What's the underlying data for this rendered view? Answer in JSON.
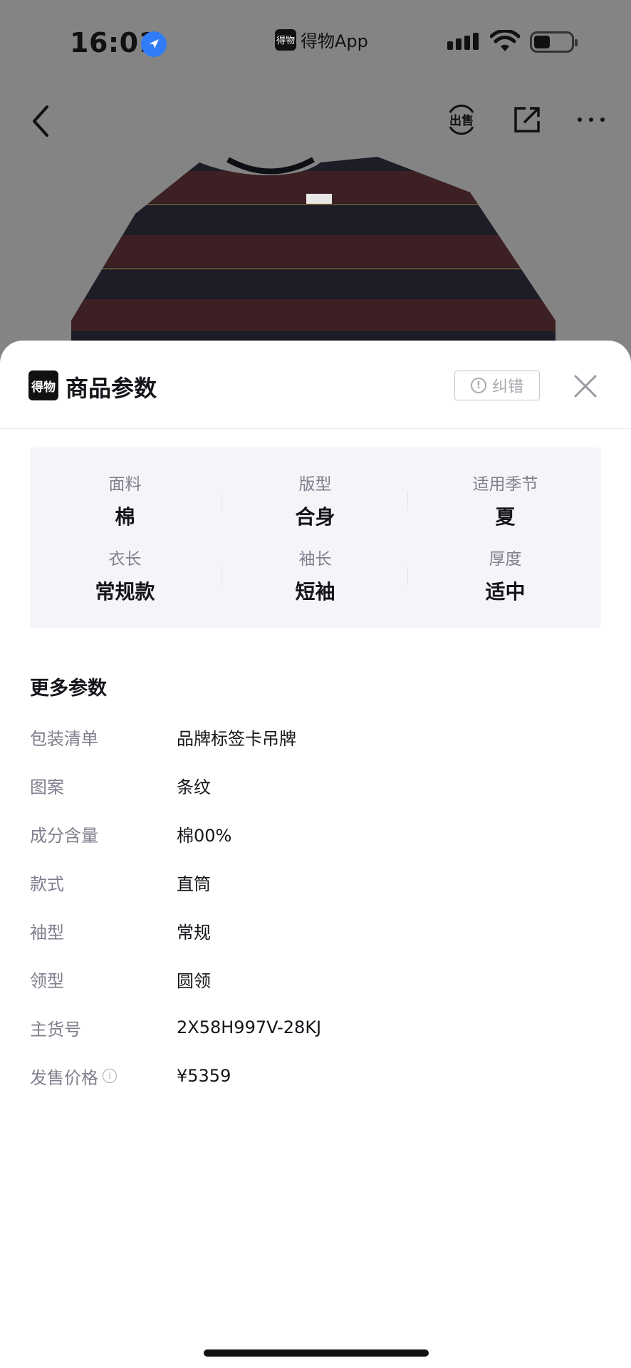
{
  "status_bar": {
    "time": "16:01",
    "app_name": "得物App",
    "app_logo_text": "得物"
  },
  "nav": {
    "sell_label": "出售"
  },
  "sheet": {
    "logo_text": "得物",
    "title": "商品参数",
    "report_label": "纠错"
  },
  "params": [
    {
      "label": "面料",
      "value": "棉"
    },
    {
      "label": "版型",
      "value": "合身"
    },
    {
      "label": "适用季节",
      "value": "夏"
    },
    {
      "label": "衣长",
      "value": "常规款"
    },
    {
      "label": "袖长",
      "value": "短袖"
    },
    {
      "label": "厚度",
      "value": "适中"
    }
  ],
  "more": {
    "title": "更多参数",
    "rows": [
      {
        "key": "包装清单",
        "value": "品牌标签卡吊牌"
      },
      {
        "key": "图案",
        "value": "条纹"
      },
      {
        "key": "成分含量",
        "value": "棉00%"
      },
      {
        "key": "款式",
        "value": "直筒"
      },
      {
        "key": "袖型",
        "value": "常规"
      },
      {
        "key": "领型",
        "value": "圆领"
      },
      {
        "key": "主货号",
        "value": "2X58H997V-28KJ"
      },
      {
        "key": "发售价格",
        "value": "¥5359"
      }
    ]
  },
  "colors": {
    "overlay": "#848484",
    "accent_blue": "#2f7cf6",
    "label_gray": "#7f7f8e",
    "text_dark": "#14151a",
    "panel_bg": "#f5f5f9"
  },
  "icons": [
    "location-arrow-icon",
    "signal-icon",
    "wifi-icon",
    "battery-icon",
    "back-arrow-icon",
    "sell-icon",
    "share-icon",
    "more-icon",
    "alert-icon",
    "close-icon",
    "info-icon"
  ]
}
